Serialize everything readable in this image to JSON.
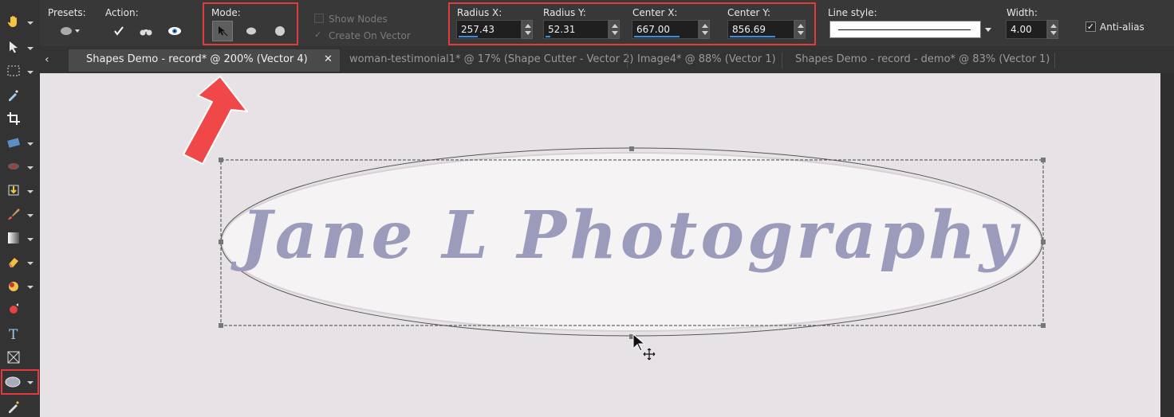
{
  "toolbar": {
    "presets_label": "Presets:",
    "action_label": "Action:",
    "mode_label": "Mode:",
    "show_nodes_label": "Show Nodes",
    "create_on_vector_label": "Create On Vector",
    "radius_x": {
      "label": "Radius X:",
      "value": "257.43",
      "bar_fraction": 0.3
    },
    "radius_y": {
      "label": "Radius Y:",
      "value": "52.31",
      "bar_fraction": 0.08
    },
    "center_x": {
      "label": "Center X:",
      "value": "667.00",
      "bar_fraction": 0.7
    },
    "center_y": {
      "label": "Center Y:",
      "value": "856.69",
      "bar_fraction": 0.7
    },
    "line_style_label": "Line style:",
    "width": {
      "label": "Width:",
      "value": "4.00"
    },
    "anti_alias_label": "Anti-alias",
    "anti_alias_checked": true
  },
  "tabs": [
    {
      "label": "Shapes Demo - record* @  200% (Vector 4)",
      "active": true
    },
    {
      "label": "woman-testimonial1* @  17% (Shape Cutter - Vector 2)",
      "active": false
    },
    {
      "label": "Image4* @  88% (Vector 1)",
      "active": false
    },
    {
      "label": "Shapes Demo - record - demo* @  83% (Vector 1)",
      "active": false
    }
  ],
  "canvas": {
    "logo_text": "Jane L Photography"
  },
  "colors": {
    "accent_red": "#e23b3b",
    "field_bar_blue": "#3a8ee6",
    "canvas_bg": "#e7e2e6",
    "logo_text": "#9b9cbc",
    "arrow_red": "#f04848"
  },
  "icons": {
    "tools": [
      "pan-hand-icon",
      "pick-arrow-icon",
      "selection-rect-icon",
      "dropper-icon",
      "crop-icon",
      "straighten-icon",
      "red-eye-icon",
      "clone-icon",
      "paint-brush-icon",
      "gradient-icon",
      "eraser-icon",
      "fill-bucket-icon",
      "picture-tube-icon",
      "text-icon",
      "vector-pick-icon",
      "ellipse-icon",
      "pen-icon"
    ]
  }
}
